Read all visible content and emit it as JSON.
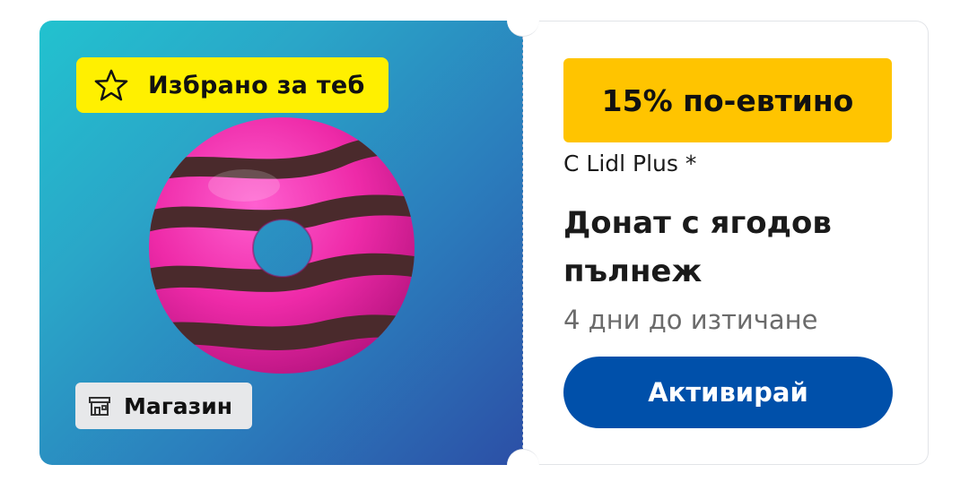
{
  "coupon": {
    "badge_selected": {
      "label": "Избрано за теб",
      "icon": "star-icon",
      "color": "#fff000"
    },
    "badge_store": {
      "label": "Магазин",
      "icon": "store-icon"
    },
    "product_image": "strawberry-donut-image",
    "discount_label": "15% по-евтино",
    "discount_color": "#ffc400",
    "with_lidl_plus": "С Lidl Plus *",
    "product_name": "Донат с ягодов пълнеж",
    "expiry": "4 дни до изтичане",
    "activate_label": "Активирай",
    "activate_color": "#0050aa"
  }
}
